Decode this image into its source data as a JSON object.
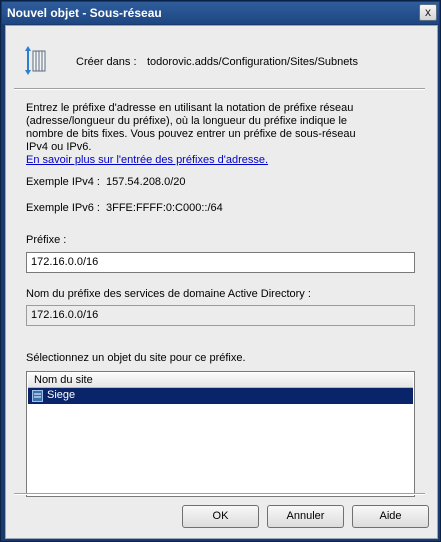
{
  "window": {
    "title": "Nouvel objet - Sous-réseau",
    "close_glyph": "x"
  },
  "header": {
    "create_in_label": "Créer dans :",
    "create_in_value": "todorovic.adds/Configuration/Sites/Subnets"
  },
  "instructions": {
    "lines": [
      "Entrez le préfixe d'adresse en utilisant la notation de préfixe réseau",
      "(adresse/longueur du préfixe), où la longueur du préfixe indique le",
      "nombre de bits fixes. Vous pouvez entrer un préfixe de sous-réseau",
      "IPv4 ou IPv6."
    ],
    "link": "En savoir plus sur l'entrée des préfixes d'adresse."
  },
  "examples": {
    "ipv4_label": "Exemple IPv4 :",
    "ipv4_value": "157.54.208.0/20",
    "ipv6_label": "Exemple IPv6 :",
    "ipv6_value": "3FFE:FFFF:0:C000::/64"
  },
  "prefix": {
    "label": "Préfixe :",
    "value": "172.16.0.0/16"
  },
  "ad_prefix": {
    "label": "Nom du préfixe des services de domaine Active Directory :",
    "value": "172.16.0.0/16"
  },
  "site": {
    "label": "Sélectionnez un objet du site pour ce préfixe.",
    "column": "Nom du site",
    "rows": [
      {
        "name": "Siege",
        "selected": true
      }
    ]
  },
  "buttons": {
    "ok": "OK",
    "cancel": "Annuler",
    "help": "Aide"
  },
  "icons": {
    "header": "subnet-container-icon",
    "site": "site-icon"
  },
  "colors": {
    "title_bar": "#1d4681",
    "selection": "#0a246a",
    "link": "#0000cc",
    "dialog_bg": "#ececec"
  }
}
